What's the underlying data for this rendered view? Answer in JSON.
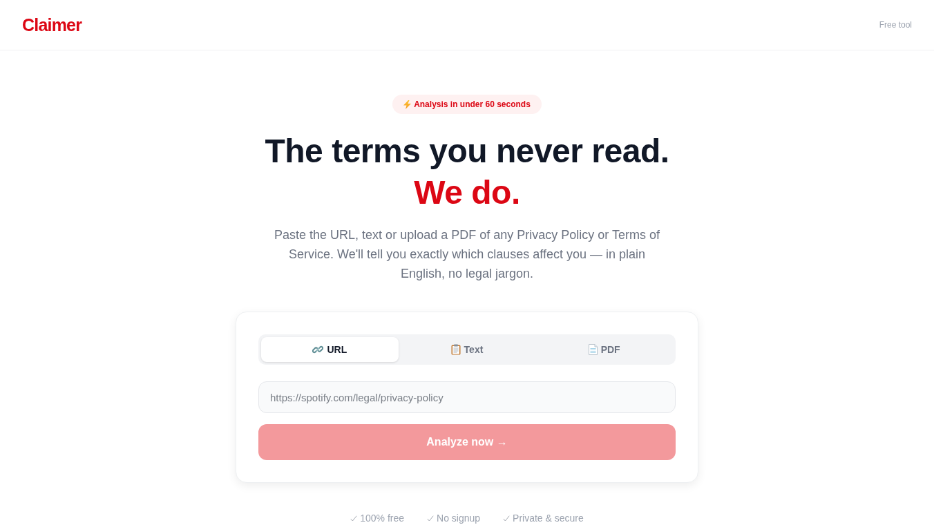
{
  "header": {
    "logo": "Claimer",
    "tagline": "Free tool"
  },
  "hero": {
    "badge": "Analysis in under 60 seconds",
    "headline": "The terms you never read.",
    "headline_accent": "We do.",
    "description": "Paste the URL, text or upload a PDF of any Privacy Policy or Terms of Service. We'll tell you exactly which clauses affect you — in plain English, no legal jargon."
  },
  "form": {
    "tabs": [
      {
        "label": "URL",
        "kind": "link",
        "selected": true
      },
      {
        "label": "Text",
        "kind": "clipboard",
        "selected": false
      },
      {
        "label": "PDF",
        "kind": "document",
        "selected": false
      }
    ],
    "url_field": {
      "placeholder": "https://spotify.com/legal/privacy-policy"
    },
    "submit": {
      "label": "Analyze now →",
      "disabled": true
    }
  },
  "trust_points": [
    "100% free",
    "No signup",
    "Private & secure"
  ]
}
